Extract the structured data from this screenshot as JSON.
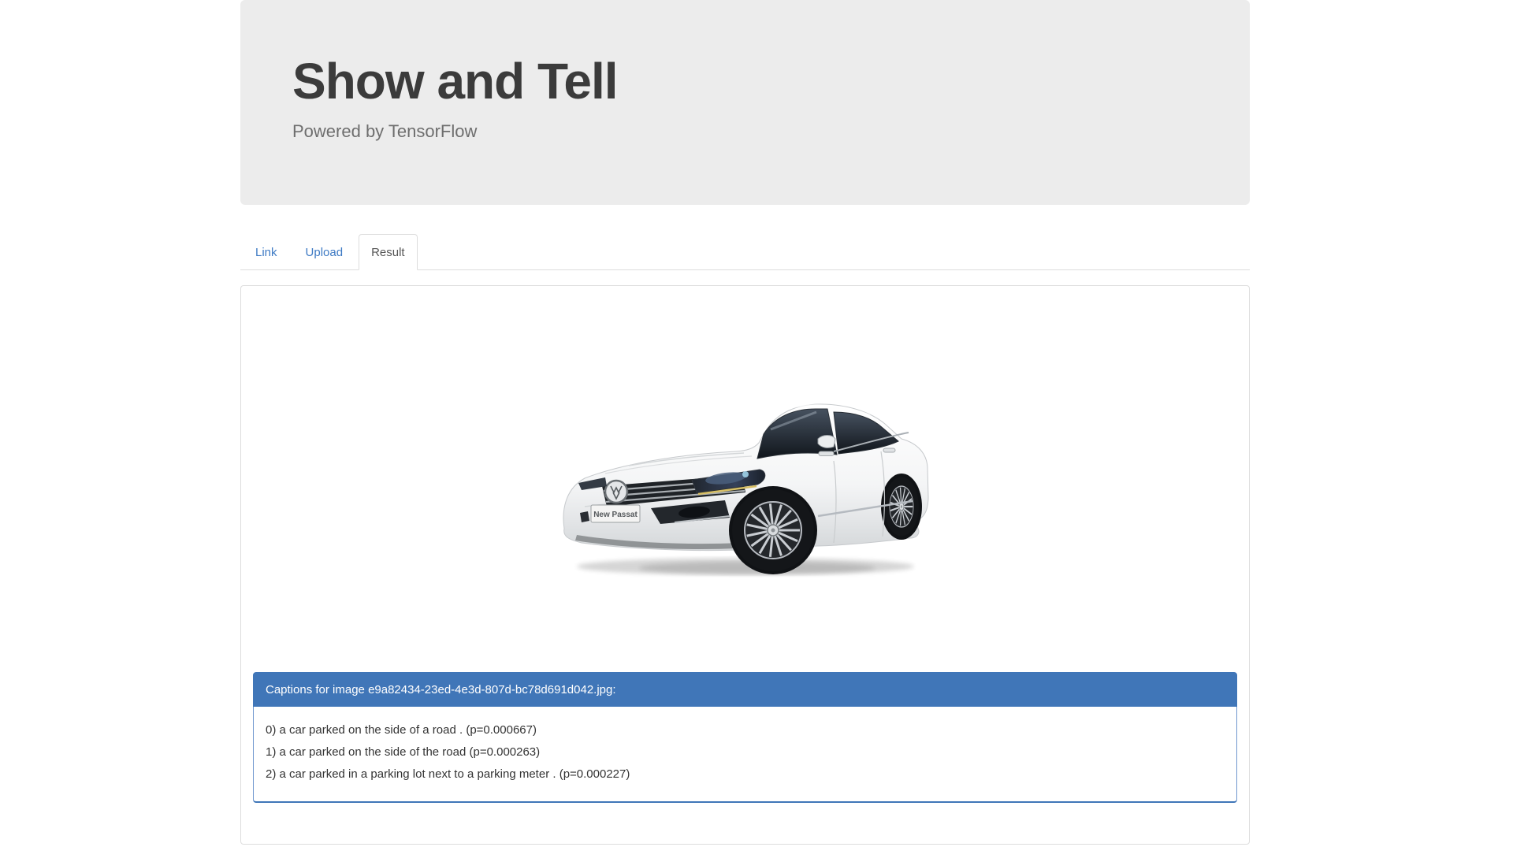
{
  "header": {
    "title": "Show and Tell",
    "subtitle": "Powered by TensorFlow"
  },
  "tabs": [
    {
      "label": "Link",
      "active": false
    },
    {
      "label": "Upload",
      "active": false
    },
    {
      "label": "Result",
      "active": true
    }
  ],
  "result": {
    "image_badge": "New Passat",
    "captions_header": "Captions for image e9a82434-23ed-4e3d-807d-bc78d691d042.jpg:",
    "captions": [
      "0) a car parked on the side of a road . (p=0.000667)",
      "1) a car parked on the side of the road (p=0.000263)",
      "2) a car parked in a parking lot next to a parking meter . (p=0.000227)"
    ]
  },
  "colors": {
    "jumbotron_bg": "#ececec",
    "title_text": "#3b3b3b",
    "subtitle_text": "#6e6e6e",
    "link_blue": "#3e7ac4",
    "active_tab_text": "#555555",
    "panel_border": "#dddddd",
    "caption_header_bg": "#4076b8",
    "caption_text": "#333333"
  }
}
